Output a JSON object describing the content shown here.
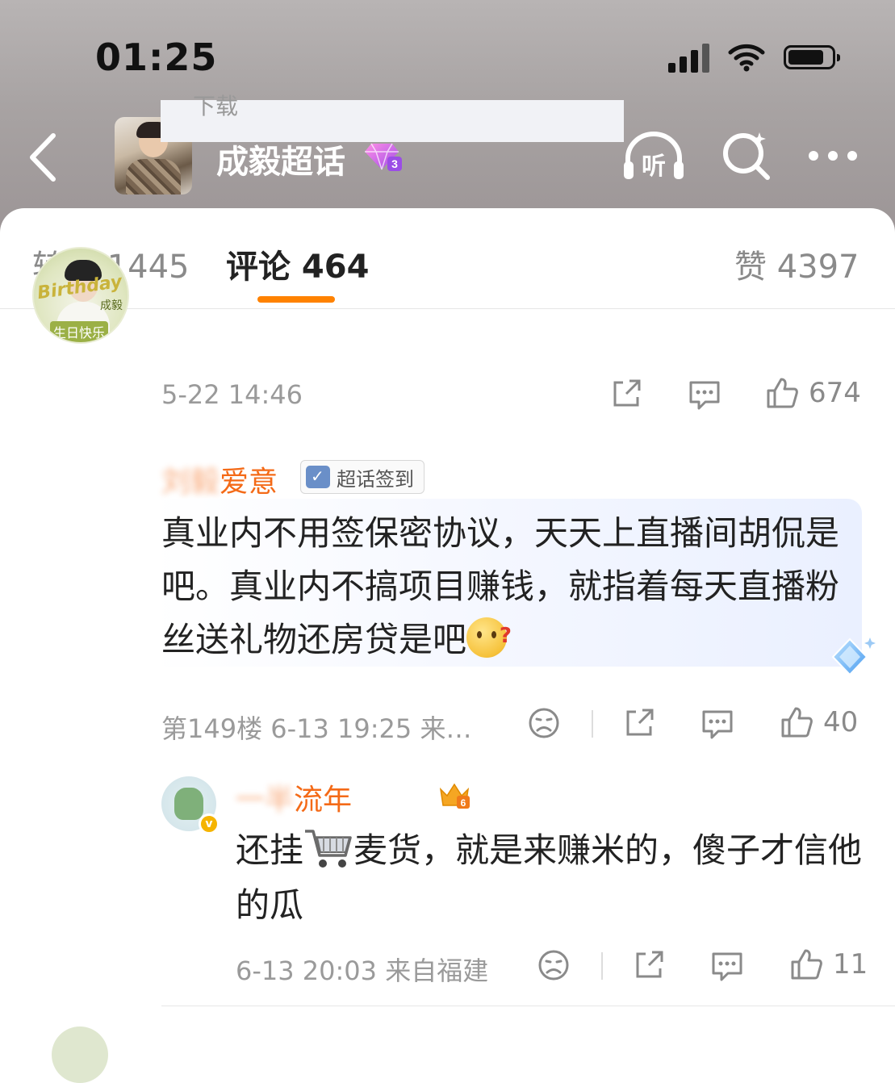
{
  "status_bar": {
    "time": "01:25"
  },
  "header": {
    "title": "成毅超话",
    "back_icon": "chevron-left-icon",
    "listen_label": "听",
    "search_icon": "search-icon",
    "more_icon": "more-horizontal-icon"
  },
  "tabs": {
    "repost": "转发 1445",
    "comments": "评论 464",
    "likes": "赞 4397",
    "active": "comments"
  },
  "post": {
    "image_caption_fragment": "下载",
    "timestamp": "5-22 14:46",
    "like_count": "674"
  },
  "comment": {
    "username": "刘毅爱意",
    "username_visible": "爱意",
    "badge": "超话签到",
    "text": "真业内不用签保密协议，天天上直播间胡侃是吧。真业内不搞项目赚钱，就指着每天直播粉丝送礼物还房贷是吧",
    "meta": "第149楼 6-13 19:25 来…",
    "like_count": "40"
  },
  "reply": {
    "username": "一半流年",
    "username_visible": "流年",
    "text_before": "还挂",
    "text_after": "麦货，就是来赚米的，傻子才信他的瓜",
    "meta": "6-13 20:03 来自福建",
    "like_count": "11"
  },
  "colors": {
    "accent": "#ff8200",
    "username": "#f46a17",
    "meta": "#9a9a9a"
  }
}
